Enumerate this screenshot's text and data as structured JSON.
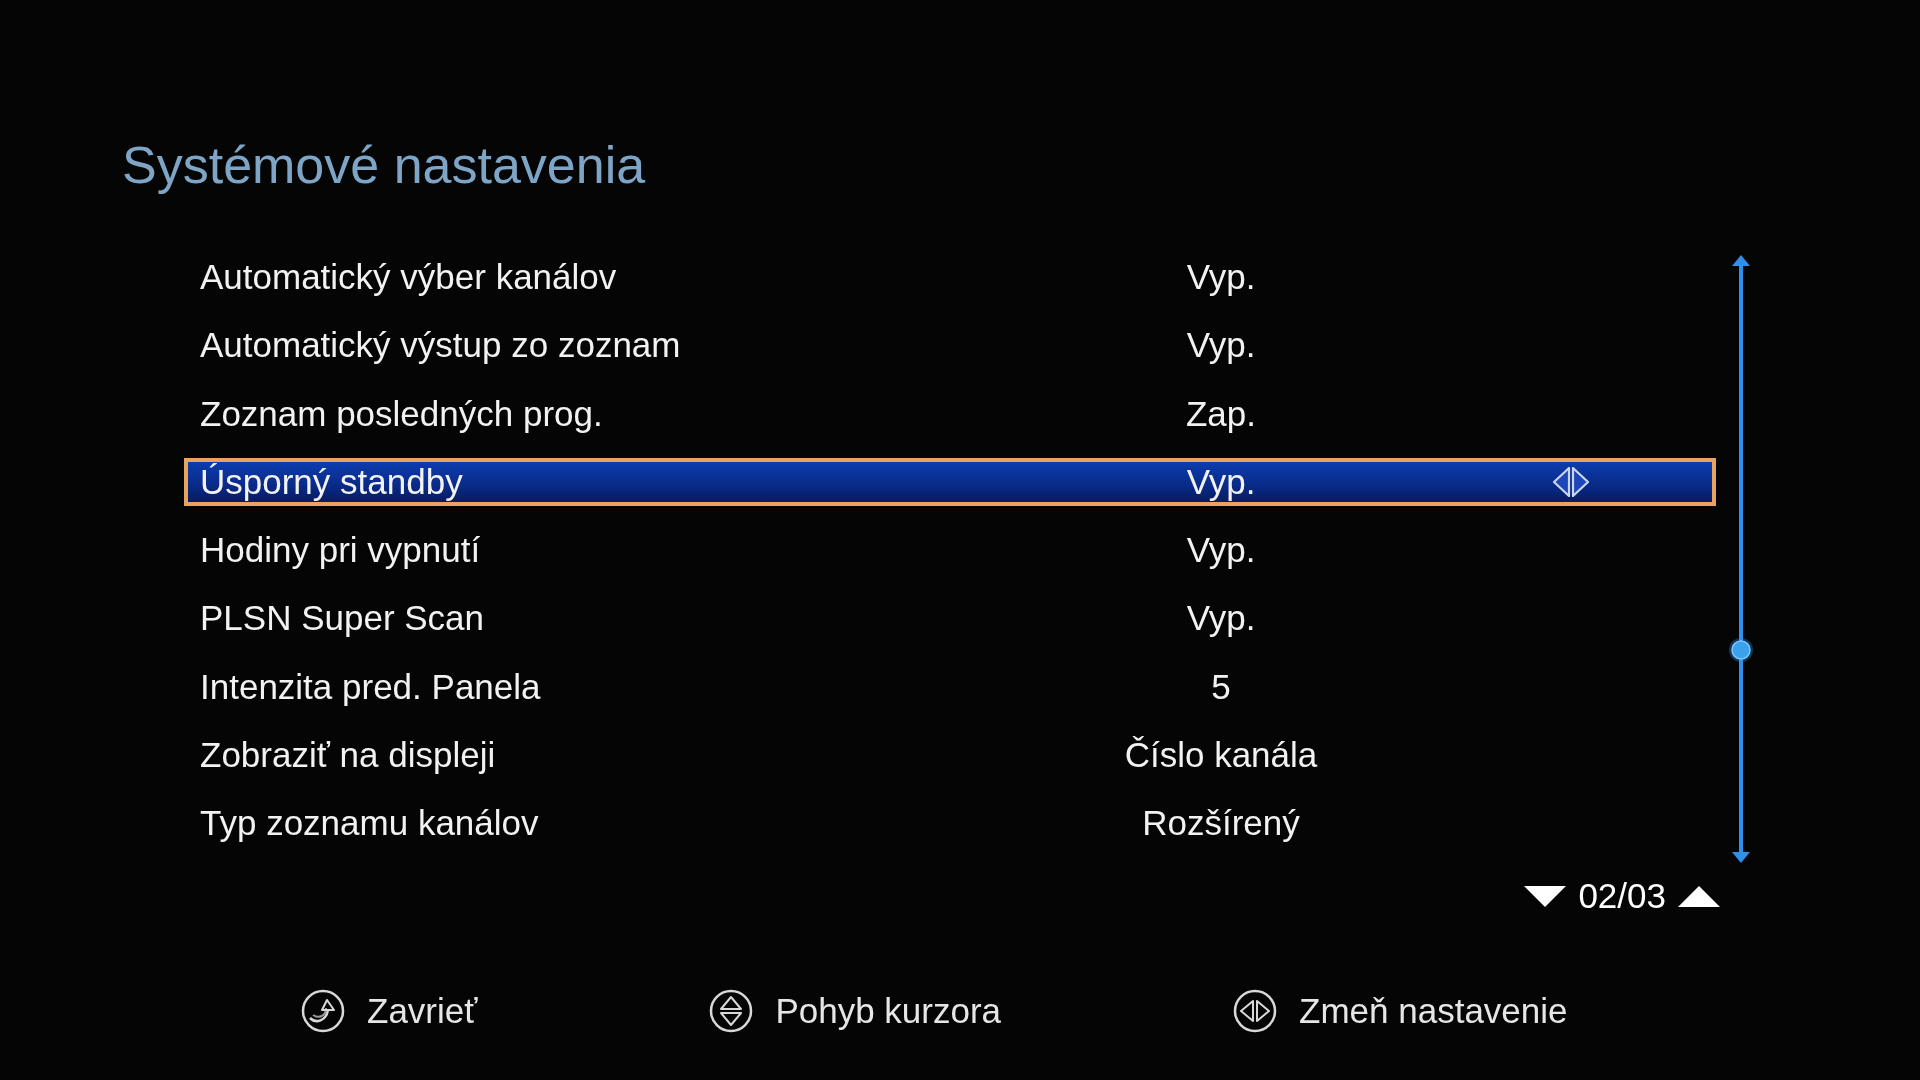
{
  "title": "Systémové nastavenia",
  "settings": [
    {
      "label": "Automatický výber kanálov",
      "value": "Vyp.",
      "selected": false
    },
    {
      "label": "Automatický výstup zo zoznam",
      "value": "Vyp.",
      "selected": false
    },
    {
      "label": "Zoznam posledných prog.",
      "value": "Zap.",
      "selected": false
    },
    {
      "label": "Úsporný standby",
      "value": "Vyp.",
      "selected": true
    },
    {
      "label": "Hodiny pri vypnutí",
      "value": "Vyp.",
      "selected": false
    },
    {
      "label": "PLSN Super Scan",
      "value": "Vyp.",
      "selected": false
    },
    {
      "label": "Intenzita pred. Panela",
      "value": "5",
      "selected": false
    },
    {
      "label": "Zobraziť na displeji",
      "value": "Číslo kanála",
      "selected": false
    },
    {
      "label": "Typ zoznamu kanálov",
      "value": "Rozšírený",
      "selected": false
    }
  ],
  "page_indicator": "02/03",
  "footer_hints": [
    {
      "kind": "exit",
      "label": "Zavrieť"
    },
    {
      "kind": "move",
      "label": "Pohyb kurzora"
    },
    {
      "kind": "change",
      "label": "Zmeň nastavenie"
    }
  ]
}
